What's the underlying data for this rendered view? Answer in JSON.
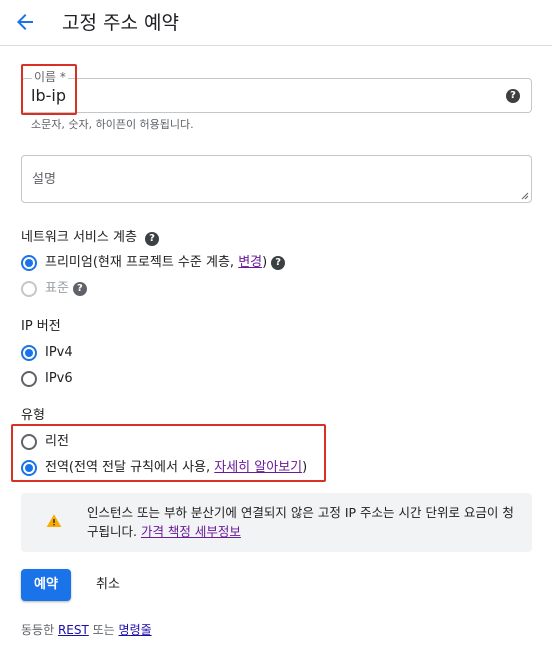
{
  "header": {
    "title": "고정 주소 예약",
    "back_icon": "arrow-back-icon"
  },
  "name_field": {
    "label": "이름 *",
    "value": "lb-ip",
    "help_glyph": "?",
    "hint": "소문자, 숫자, 하이픈이 허용됩니다."
  },
  "description_field": {
    "placeholder": "설명"
  },
  "network_tier": {
    "label": "네트워크 서비스 계층",
    "help_glyph": "?",
    "options": [
      {
        "label": "프리미엄(현재 프로젝트 수준 계층, ",
        "link": "변경",
        "suffix": ")",
        "checked": true,
        "disabled": false
      },
      {
        "label": "표준",
        "checked": false,
        "disabled": true
      }
    ]
  },
  "ip_version": {
    "label": "IP 버전",
    "options": [
      {
        "label": "IPv4",
        "checked": true
      },
      {
        "label": "IPv6",
        "checked": false
      }
    ]
  },
  "type": {
    "label": "유형",
    "options": [
      {
        "label": "리전",
        "checked": false
      },
      {
        "label": "전역(전역 전달 규칙에서 사용, ",
        "link": "자세히 알아보기",
        "suffix": ")",
        "checked": true
      }
    ]
  },
  "notice": {
    "text": "인스턴스 또는 부하 분산기에 연결되지 않은 고정 IP 주소는 시간 단위로 요금이 청구됩니다. ",
    "link": "가격 책정 세부정보"
  },
  "actions": {
    "reserve_label": "예약",
    "cancel_label": "취소"
  },
  "footer": {
    "prefix": "동등한 ",
    "rest_link": "REST",
    "middle": " 또는 ",
    "command_link": "명령줄"
  },
  "colors": {
    "accent": "#1a73e8",
    "highlight_box": "#d93025",
    "warning": "#f9ab00",
    "link_visited": "#6a1b9a"
  }
}
